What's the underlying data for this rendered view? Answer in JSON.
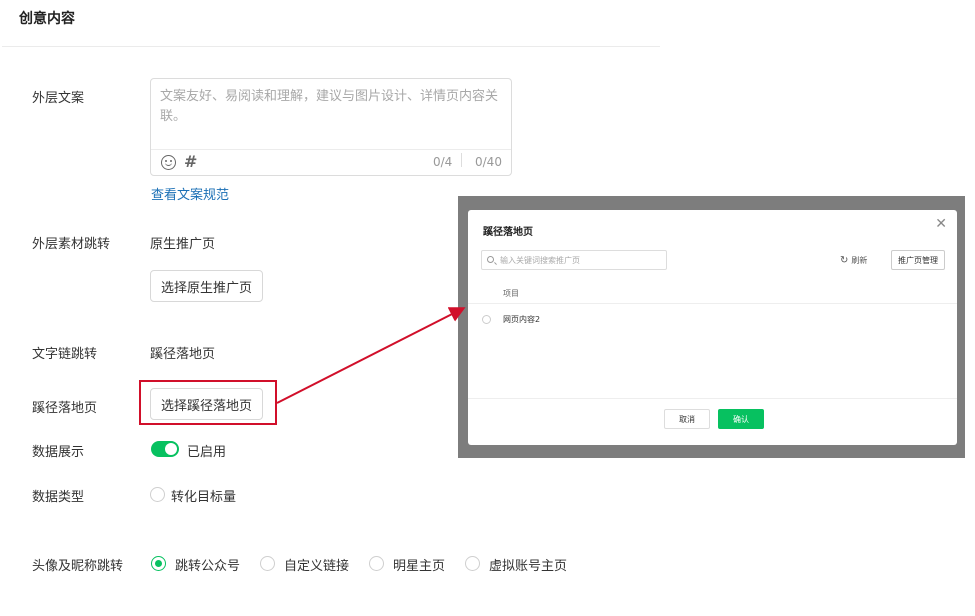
{
  "section": {
    "title": "创意内容"
  },
  "outer_copy": {
    "label": "外层文案",
    "placeholder": "文案友好、易阅读和理解，建议与图片设计、详情页内容关联。",
    "counter_a": "0/4",
    "counter_b": "0/40",
    "guide_link": "查看文案规范"
  },
  "outer_material_jump": {
    "label": "外层素材跳转",
    "value": "原生推广页",
    "button": "选择原生推广页"
  },
  "text_link_jump": {
    "label": "文字链跳转",
    "value": "蹊径落地页"
  },
  "landing_page": {
    "label": "蹊径落地页",
    "button": "选择蹊径落地页"
  },
  "data_display": {
    "label": "数据展示",
    "toggle_on": true,
    "status": "已启用"
  },
  "data_type": {
    "label": "数据类型",
    "option": "转化目标量"
  },
  "avatar_jump": {
    "label": "头像及昵称跳转",
    "options": [
      "跳转公众号",
      "自定义链接",
      "明星主页",
      "虚拟账号主页"
    ],
    "selected": "跳转公众号"
  },
  "modal": {
    "title": "蹊径落地页",
    "search_placeholder": "输入关键词搜索推广页",
    "refresh": "刷新",
    "manage_button": "推广页管理",
    "column": "项目",
    "row": "网页内容2",
    "cancel": "取消",
    "confirm": "确认"
  },
  "colors": {
    "accent_green": "#07c160",
    "link_blue": "#1a6fb5",
    "highlight_red": "#d10f2a"
  }
}
